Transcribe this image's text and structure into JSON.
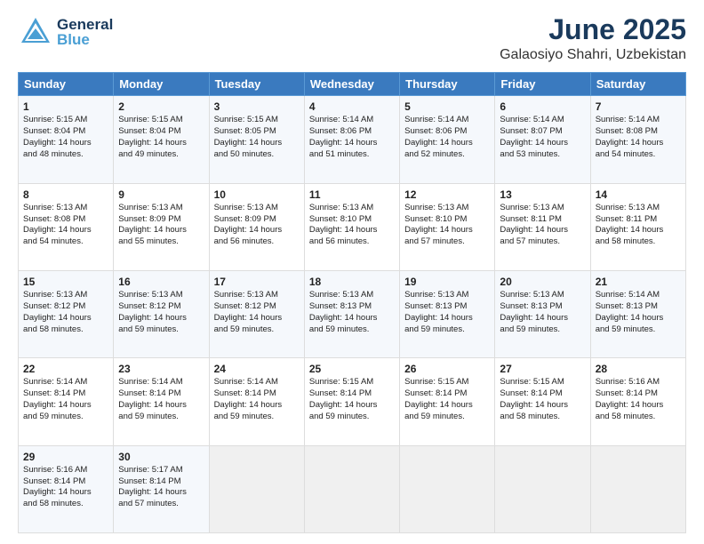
{
  "header": {
    "logo_general": "General",
    "logo_blue": "Blue",
    "title": "June 2025",
    "subtitle": "Galaosiyo Shahri, Uzbekistan"
  },
  "days_of_week": [
    "Sunday",
    "Monday",
    "Tuesday",
    "Wednesday",
    "Thursday",
    "Friday",
    "Saturday"
  ],
  "weeks": [
    [
      {
        "day": "1",
        "lines": [
          "Sunrise: 5:15 AM",
          "Sunset: 8:04 PM",
          "Daylight: 14 hours",
          "and 48 minutes."
        ]
      },
      {
        "day": "2",
        "lines": [
          "Sunrise: 5:15 AM",
          "Sunset: 8:04 PM",
          "Daylight: 14 hours",
          "and 49 minutes."
        ]
      },
      {
        "day": "3",
        "lines": [
          "Sunrise: 5:15 AM",
          "Sunset: 8:05 PM",
          "Daylight: 14 hours",
          "and 50 minutes."
        ]
      },
      {
        "day": "4",
        "lines": [
          "Sunrise: 5:14 AM",
          "Sunset: 8:06 PM",
          "Daylight: 14 hours",
          "and 51 minutes."
        ]
      },
      {
        "day": "5",
        "lines": [
          "Sunrise: 5:14 AM",
          "Sunset: 8:06 PM",
          "Daylight: 14 hours",
          "and 52 minutes."
        ]
      },
      {
        "day": "6",
        "lines": [
          "Sunrise: 5:14 AM",
          "Sunset: 8:07 PM",
          "Daylight: 14 hours",
          "and 53 minutes."
        ]
      },
      {
        "day": "7",
        "lines": [
          "Sunrise: 5:14 AM",
          "Sunset: 8:08 PM",
          "Daylight: 14 hours",
          "and 54 minutes."
        ]
      }
    ],
    [
      {
        "day": "8",
        "lines": [
          "Sunrise: 5:13 AM",
          "Sunset: 8:08 PM",
          "Daylight: 14 hours",
          "and 54 minutes."
        ]
      },
      {
        "day": "9",
        "lines": [
          "Sunrise: 5:13 AM",
          "Sunset: 8:09 PM",
          "Daylight: 14 hours",
          "and 55 minutes."
        ]
      },
      {
        "day": "10",
        "lines": [
          "Sunrise: 5:13 AM",
          "Sunset: 8:09 PM",
          "Daylight: 14 hours",
          "and 56 minutes."
        ]
      },
      {
        "day": "11",
        "lines": [
          "Sunrise: 5:13 AM",
          "Sunset: 8:10 PM",
          "Daylight: 14 hours",
          "and 56 minutes."
        ]
      },
      {
        "day": "12",
        "lines": [
          "Sunrise: 5:13 AM",
          "Sunset: 8:10 PM",
          "Daylight: 14 hours",
          "and 57 minutes."
        ]
      },
      {
        "day": "13",
        "lines": [
          "Sunrise: 5:13 AM",
          "Sunset: 8:11 PM",
          "Daylight: 14 hours",
          "and 57 minutes."
        ]
      },
      {
        "day": "14",
        "lines": [
          "Sunrise: 5:13 AM",
          "Sunset: 8:11 PM",
          "Daylight: 14 hours",
          "and 58 minutes."
        ]
      }
    ],
    [
      {
        "day": "15",
        "lines": [
          "Sunrise: 5:13 AM",
          "Sunset: 8:12 PM",
          "Daylight: 14 hours",
          "and 58 minutes."
        ]
      },
      {
        "day": "16",
        "lines": [
          "Sunrise: 5:13 AM",
          "Sunset: 8:12 PM",
          "Daylight: 14 hours",
          "and 59 minutes."
        ]
      },
      {
        "day": "17",
        "lines": [
          "Sunrise: 5:13 AM",
          "Sunset: 8:12 PM",
          "Daylight: 14 hours",
          "and 59 minutes."
        ]
      },
      {
        "day": "18",
        "lines": [
          "Sunrise: 5:13 AM",
          "Sunset: 8:13 PM",
          "Daylight: 14 hours",
          "and 59 minutes."
        ]
      },
      {
        "day": "19",
        "lines": [
          "Sunrise: 5:13 AM",
          "Sunset: 8:13 PM",
          "Daylight: 14 hours",
          "and 59 minutes."
        ]
      },
      {
        "day": "20",
        "lines": [
          "Sunrise: 5:13 AM",
          "Sunset: 8:13 PM",
          "Daylight: 14 hours",
          "and 59 minutes."
        ]
      },
      {
        "day": "21",
        "lines": [
          "Sunrise: 5:14 AM",
          "Sunset: 8:13 PM",
          "Daylight: 14 hours",
          "and 59 minutes."
        ]
      }
    ],
    [
      {
        "day": "22",
        "lines": [
          "Sunrise: 5:14 AM",
          "Sunset: 8:14 PM",
          "Daylight: 14 hours",
          "and 59 minutes."
        ]
      },
      {
        "day": "23",
        "lines": [
          "Sunrise: 5:14 AM",
          "Sunset: 8:14 PM",
          "Daylight: 14 hours",
          "and 59 minutes."
        ]
      },
      {
        "day": "24",
        "lines": [
          "Sunrise: 5:14 AM",
          "Sunset: 8:14 PM",
          "Daylight: 14 hours",
          "and 59 minutes."
        ]
      },
      {
        "day": "25",
        "lines": [
          "Sunrise: 5:15 AM",
          "Sunset: 8:14 PM",
          "Daylight: 14 hours",
          "and 59 minutes."
        ]
      },
      {
        "day": "26",
        "lines": [
          "Sunrise: 5:15 AM",
          "Sunset: 8:14 PM",
          "Daylight: 14 hours",
          "and 59 minutes."
        ]
      },
      {
        "day": "27",
        "lines": [
          "Sunrise: 5:15 AM",
          "Sunset: 8:14 PM",
          "Daylight: 14 hours",
          "and 58 minutes."
        ]
      },
      {
        "day": "28",
        "lines": [
          "Sunrise: 5:16 AM",
          "Sunset: 8:14 PM",
          "Daylight: 14 hours",
          "and 58 minutes."
        ]
      }
    ],
    [
      {
        "day": "29",
        "lines": [
          "Sunrise: 5:16 AM",
          "Sunset: 8:14 PM",
          "Daylight: 14 hours",
          "and 58 minutes."
        ]
      },
      {
        "day": "30",
        "lines": [
          "Sunrise: 5:17 AM",
          "Sunset: 8:14 PM",
          "Daylight: 14 hours",
          "and 57 minutes."
        ]
      },
      {
        "day": "",
        "lines": []
      },
      {
        "day": "",
        "lines": []
      },
      {
        "day": "",
        "lines": []
      },
      {
        "day": "",
        "lines": []
      },
      {
        "day": "",
        "lines": []
      }
    ]
  ]
}
